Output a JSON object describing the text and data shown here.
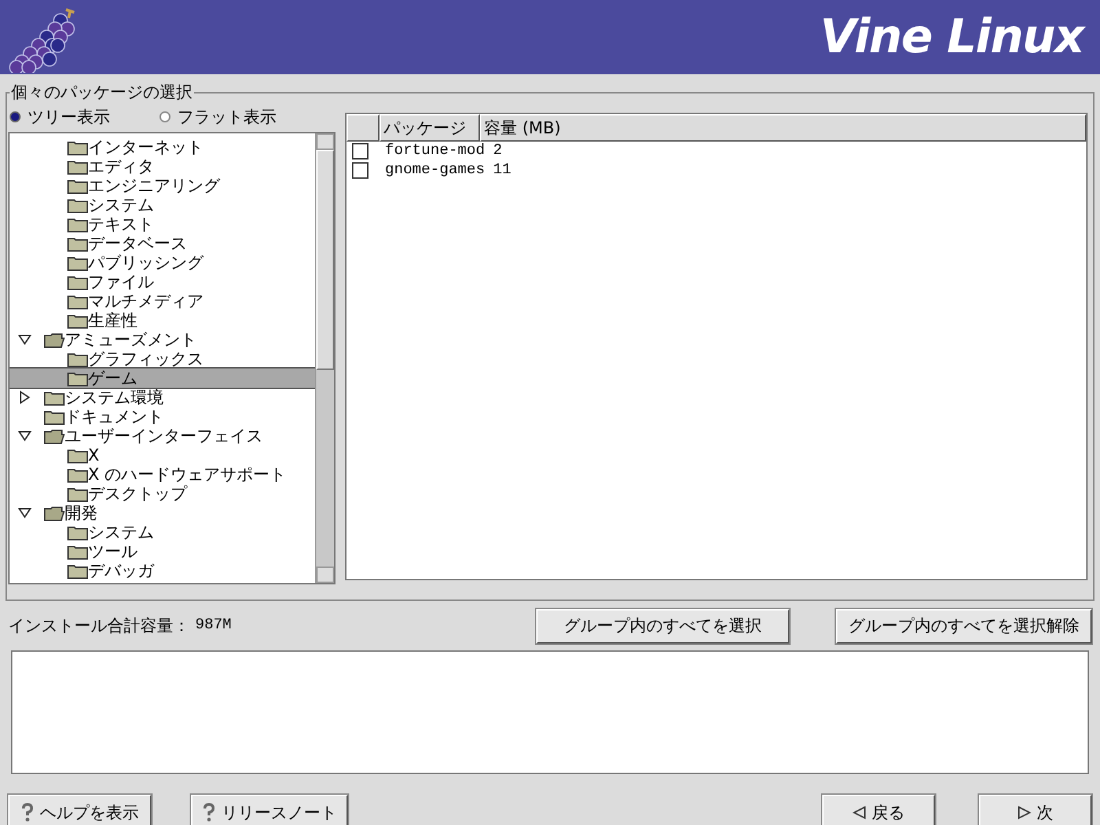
{
  "header": {
    "title": "Vine Linux"
  },
  "group_title": "個々のパッケージの選択",
  "view_options": [
    {
      "label": "ツリー表示",
      "selected": true
    },
    {
      "label": "フラット表示",
      "selected": false
    }
  ],
  "tree": {
    "continued_children": [
      {
        "label": "インターネット",
        "selected": false
      },
      {
        "label": "エディタ",
        "selected": false
      },
      {
        "label": "エンジニアリング",
        "selected": false
      },
      {
        "label": "システム",
        "selected": false
      },
      {
        "label": "テキスト",
        "selected": false
      },
      {
        "label": "データベース",
        "selected": false
      },
      {
        "label": "パブリッシング",
        "selected": false
      },
      {
        "label": "ファイル",
        "selected": false
      },
      {
        "label": "マルチメディア",
        "selected": false
      },
      {
        "label": "生産性",
        "selected": false
      }
    ],
    "items": [
      {
        "label": "アミューズメント",
        "kind": "group",
        "expanded": true,
        "children": [
          {
            "label": "グラフィックス",
            "selected": false
          },
          {
            "label": "ゲーム",
            "selected": true
          }
        ]
      },
      {
        "label": "システム環境",
        "kind": "group",
        "expanded": false
      },
      {
        "label": "ドキュメント",
        "kind": "leaf"
      },
      {
        "label": "ユーザーインターフェイス",
        "kind": "group",
        "expanded": true,
        "children": [
          {
            "label": "X",
            "selected": false
          },
          {
            "label": "X のハードウェアサポート",
            "selected": false
          },
          {
            "label": "デスクトップ",
            "selected": false
          }
        ]
      },
      {
        "label": "開発",
        "kind": "group",
        "expanded": true,
        "children": [
          {
            "label": "システム",
            "selected": false
          },
          {
            "label": "ツール",
            "selected": false
          },
          {
            "label": "デバッガ",
            "selected": false
          }
        ]
      }
    ]
  },
  "table": {
    "columns": [
      "パッケージ",
      "容量 (MB)"
    ],
    "rows": [
      {
        "name": "fortune-mod",
        "size": "2",
        "checked": false
      },
      {
        "name": "gnome-games",
        "size": "11",
        "checked": false
      }
    ]
  },
  "total_size": {
    "label": "インストール合計容量：",
    "value": "987M"
  },
  "group_buttons": [
    "グループ内のすべてを選択",
    "グループ内のすべてを選択解除"
  ],
  "help_buttons": [
    "ヘルプを表示",
    "リリースノート"
  ],
  "back_button": "戻る",
  "next_button": "次"
}
